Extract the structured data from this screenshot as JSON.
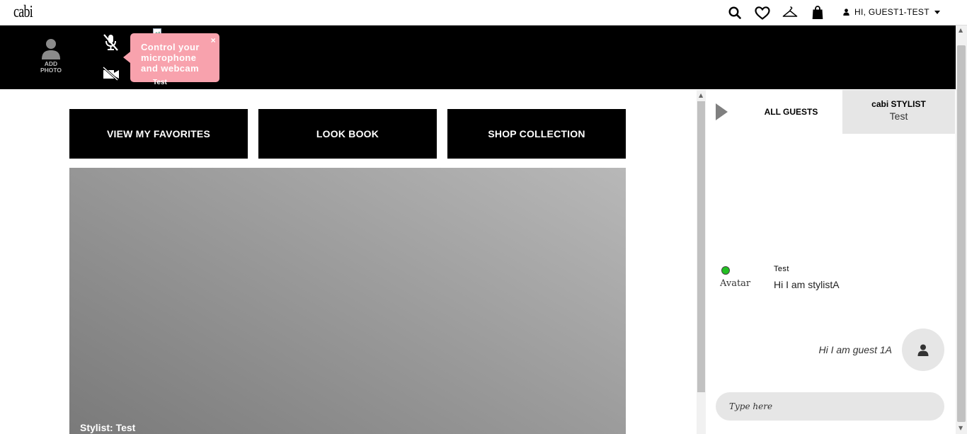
{
  "header": {
    "logo": "cabi",
    "icons": [
      "search-icon",
      "heart-icon",
      "hanger-icon",
      "bag-icon"
    ],
    "user_label": "HI, GUEST1-TEST"
  },
  "media_bar": {
    "add_photo_line1": "ADD",
    "add_photo_line2": "PHOTO",
    "tooltip_text": "Control your microphone and webcam",
    "tooltip_close": "×",
    "participant_label": "Test"
  },
  "buttons": {
    "favorites": "VIEW MY FAVORITES",
    "lookbook": "LOOK BOOK",
    "shop": "SHOP COLLECTION"
  },
  "video": {
    "caption": "Stylist: Test"
  },
  "chat": {
    "tab_all": "ALL GUESTS",
    "tab_stylist_title": "cabi STYLIST",
    "tab_stylist_name": "Test",
    "messages": [
      {
        "sender": "Test",
        "avatar_alt": "Avatar",
        "text": "Hi I am stylistA"
      },
      {
        "text": "Hi I am guest 1A"
      }
    ],
    "input_placeholder": "Type here"
  },
  "colors": {
    "tooltip": "#f8a2ad",
    "online": "#22c022",
    "bar": "#000000"
  }
}
